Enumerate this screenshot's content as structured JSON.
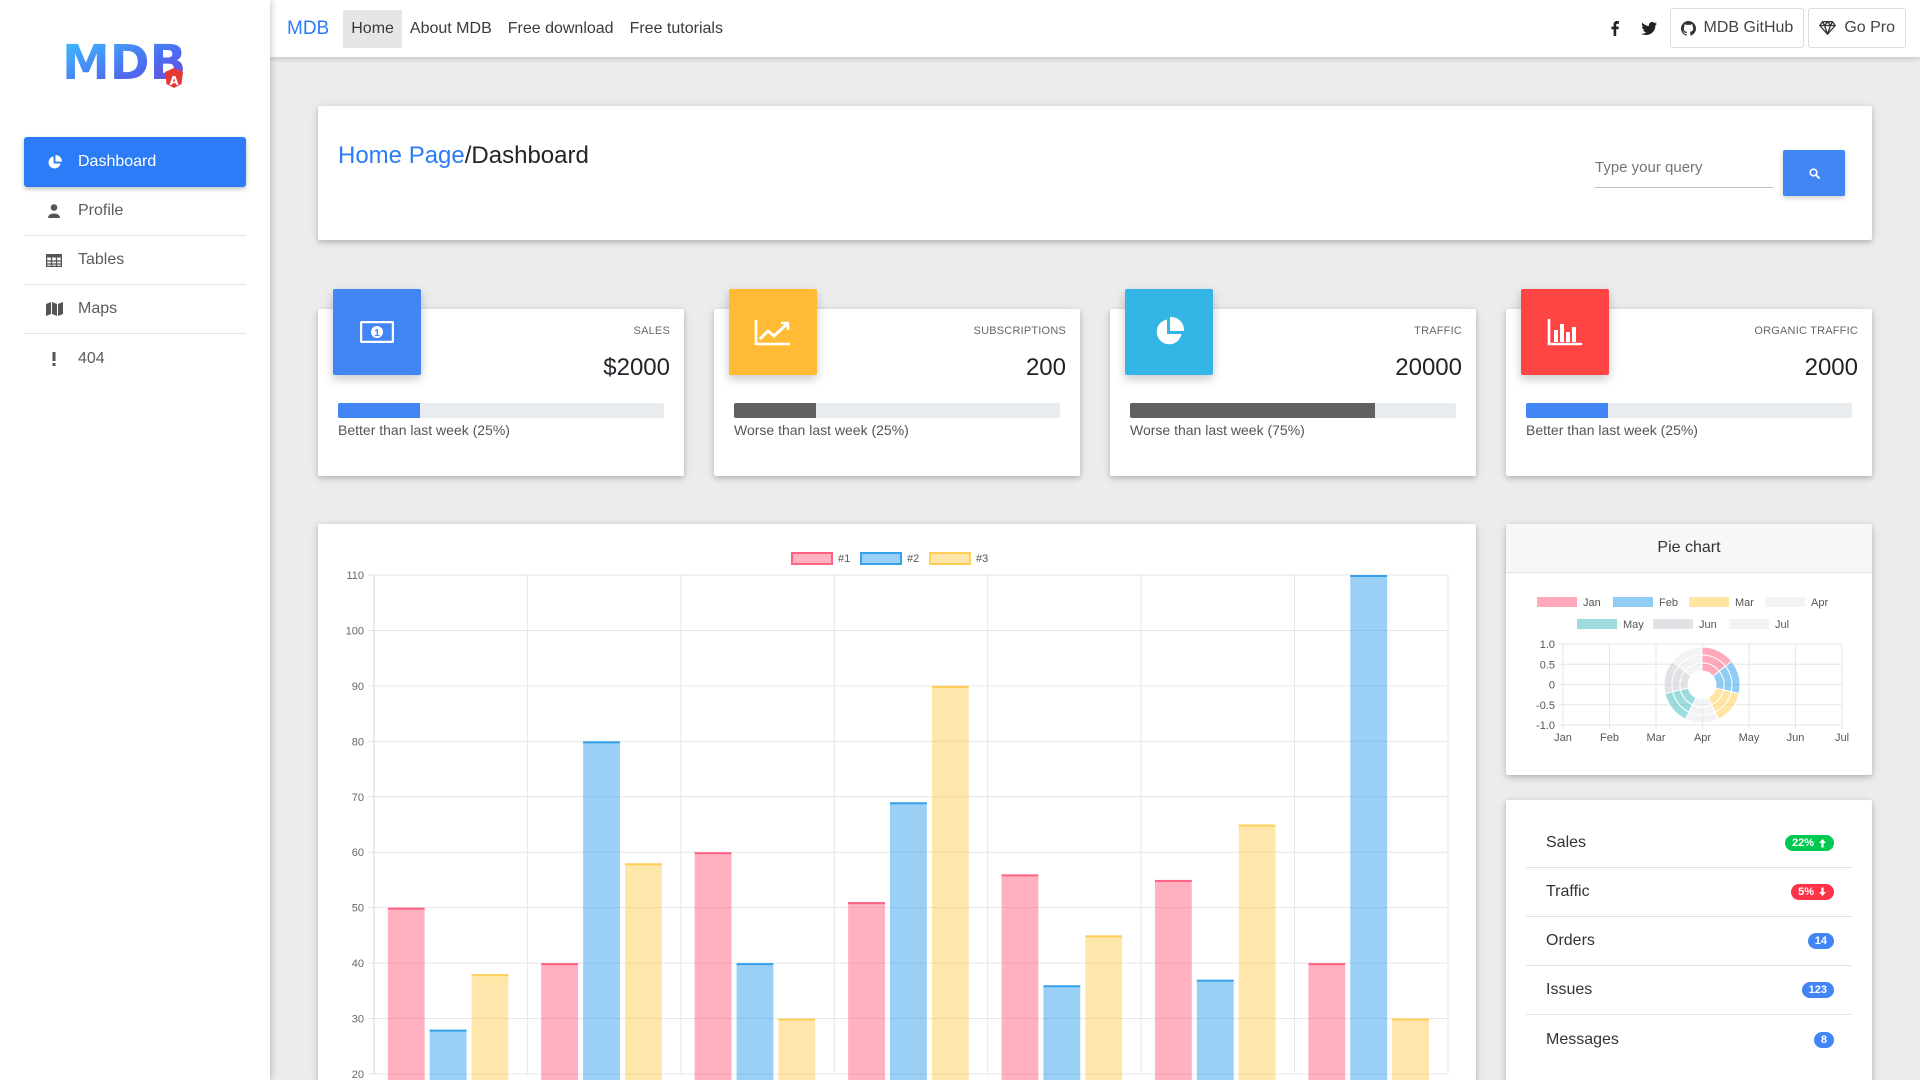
{
  "sidebar": {
    "logo_text": "MDB",
    "logo_badge": "A",
    "items": [
      {
        "label": "Dashboard",
        "icon": "pie-chart-icon",
        "active": true
      },
      {
        "label": "Profile",
        "icon": "user-icon"
      },
      {
        "label": "Tables",
        "icon": "table-icon"
      },
      {
        "label": "Maps",
        "icon": "map-icon"
      },
      {
        "label": "404",
        "icon": "exclamation-icon"
      }
    ]
  },
  "nav": {
    "brand": "MDB",
    "links": [
      "Home",
      "About MDB",
      "Free download",
      "Free tutorials"
    ],
    "github_label": "MDB GitHub",
    "pro_label": "Go Pro"
  },
  "header": {
    "breadcrumb_link": "Home Page",
    "separator": "/",
    "breadcrumb_current": "Dashboard",
    "search_placeholder": "Type your query"
  },
  "stats": [
    {
      "label": "SALES",
      "value": "$2000",
      "progress": 25,
      "note": "Better than last week (25%)",
      "icon": "money-icon",
      "color": "#4285f4",
      "bar_color": "#4285f4"
    },
    {
      "label": "SUBSCRIPTIONS",
      "value": "200",
      "progress": 25,
      "note": "Worse than last week (25%)",
      "icon": "line-chart-icon",
      "color": "#ffbb33",
      "bar_color": "#616161"
    },
    {
      "label": "TRAFFIC",
      "value": "20000",
      "progress": 75,
      "note": "Worse than last week (75%)",
      "icon": "pie-chart-icon",
      "color": "#33b5e5",
      "bar_color": "#616161"
    },
    {
      "label": "ORGANIC TRAFFIC",
      "value": "2000",
      "progress": 25,
      "note": "Better than last week (25%)",
      "icon": "bar-chart-icon",
      "color": "#ff4444",
      "bar_color": "#4285f4"
    }
  ],
  "chart_data": [
    {
      "type": "bar",
      "legend": [
        "#1",
        "#2",
        "#3"
      ],
      "series": [
        {
          "name": "#1",
          "color": "#ff6384",
          "values": [
            50,
            40,
            60,
            51,
            56,
            55,
            40
          ]
        },
        {
          "name": "#2",
          "color": "#36a2eb",
          "values": [
            28,
            80,
            40,
            69,
            36,
            37,
            110
          ]
        },
        {
          "name": "#3",
          "color": "#ffce56",
          "values": [
            38,
            58,
            30,
            90,
            45,
            65,
            30
          ]
        }
      ],
      "yticks": [
        20,
        30,
        40,
        50,
        60,
        70,
        80,
        90,
        100,
        110
      ],
      "ylim": [
        20,
        110
      ],
      "grid": true,
      "legend_position": "top"
    },
    {
      "type": "pie",
      "title": "Pie chart",
      "categories": [
        "Jan",
        "Feb",
        "Mar",
        "Apr",
        "May",
        "Jun",
        "Jul"
      ],
      "colors": [
        "#ff6384",
        "#36a2eb",
        "#ffce56",
        "#e7e9ed",
        "#4bc0c0",
        "#c9cbcf",
        "#e7e9ed"
      ],
      "yticks": [
        "1.0",
        "0.5",
        "0",
        "-0.5",
        "-1.0"
      ],
      "xticks": [
        "Jan",
        "Feb",
        "Mar",
        "Apr",
        "May",
        "Jun",
        "Jul"
      ]
    }
  ],
  "list": [
    {
      "label": "Sales",
      "badge": "22%",
      "badge_color": "#00c851",
      "arrow": "up"
    },
    {
      "label": "Traffic",
      "badge": "5%",
      "badge_color": "#ff3547",
      "arrow": "down"
    },
    {
      "label": "Orders",
      "badge": "14",
      "badge_color": "#4285f4",
      "arrow": ""
    },
    {
      "label": "Issues",
      "badge": "123",
      "badge_color": "#4285f4",
      "arrow": ""
    },
    {
      "label": "Messages",
      "badge": "8",
      "badge_color": "#4285f4",
      "arrow": ""
    }
  ]
}
